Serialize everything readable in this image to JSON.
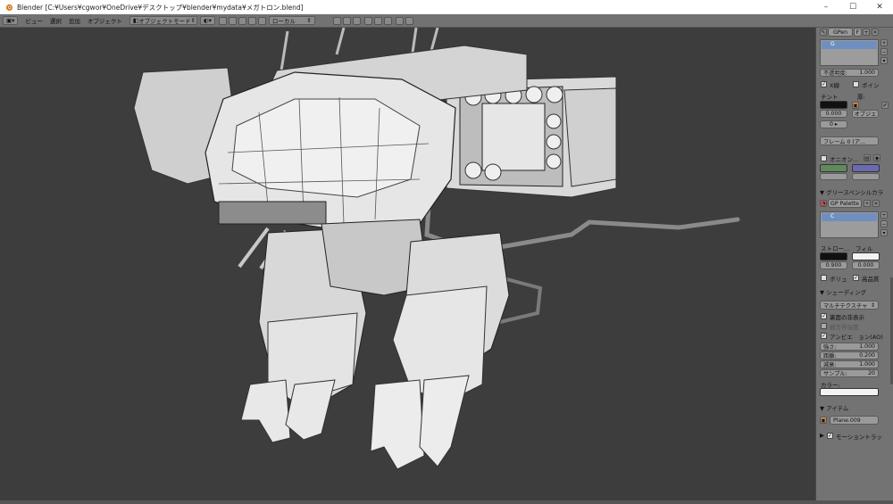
{
  "window": {
    "title": "Blender [C:¥Users¥cgwor¥OneDrive¥デスクトップ¥blender¥mydata¥メガトロン.blend]",
    "minimize": "–",
    "maximize": "☐",
    "close": "✕"
  },
  "header": {
    "menus": [
      "ビュー",
      "選択",
      "追加",
      "オブジェクト"
    ],
    "mode": "オブジェクトモード",
    "orientation": "ローカル"
  },
  "panel": {
    "gpen_label": "GPen",
    "gpen_f": "F",
    "layer_letter": "G",
    "opacity_label": "不透明度:",
    "opacity_value": "1.000",
    "xray_label": "X線",
    "points_label": "ポイン",
    "tint_label": "チント",
    "thickness_label": "厚:",
    "tint_value": "0.000",
    "object_label": "オブジェ",
    "frame_label": "フレーム 0 (ア…",
    "onion_label": "オニオン…",
    "colors_section": "グリースペンシルカラ",
    "palette_label": "GP Palette",
    "palette_letter": "C",
    "stroke_label": "ストロー…",
    "fill_label": "フィル",
    "stroke_value": "0.900",
    "fill_value": "0.000",
    "volumetric_label": "ボリュ",
    "high_quality_label": "高品質",
    "shading_section": "シェーディング",
    "matcap_label": "マルチテクスチャ",
    "backface_label": "裏面の非表示",
    "depth_label": "被写界深度",
    "ao_label": "アンビエ　ョン(AO)",
    "ao_strength_label": "強さ:",
    "ao_strength": "1.000",
    "ao_distance_label": "距離:",
    "ao_distance": "0.200",
    "ao_attenuation_label": "減衰:",
    "ao_attenuation": "1.000",
    "ao_samples_label": "サンプル:",
    "ao_samples": "20",
    "color_label": "カラー:",
    "item_section": "アイテム",
    "item_name": "Plane.009",
    "motion_label": "モーショントラッ"
  },
  "colors": {
    "viewport_bg": "#3d3d3d",
    "panel_bg": "#737373",
    "onion_before": "#5f8a5a",
    "onion_after": "#6a6ab0",
    "stroke_color": "#111111",
    "fill_color": "#f2f2f2",
    "active_slot": "#6f8fc0"
  }
}
